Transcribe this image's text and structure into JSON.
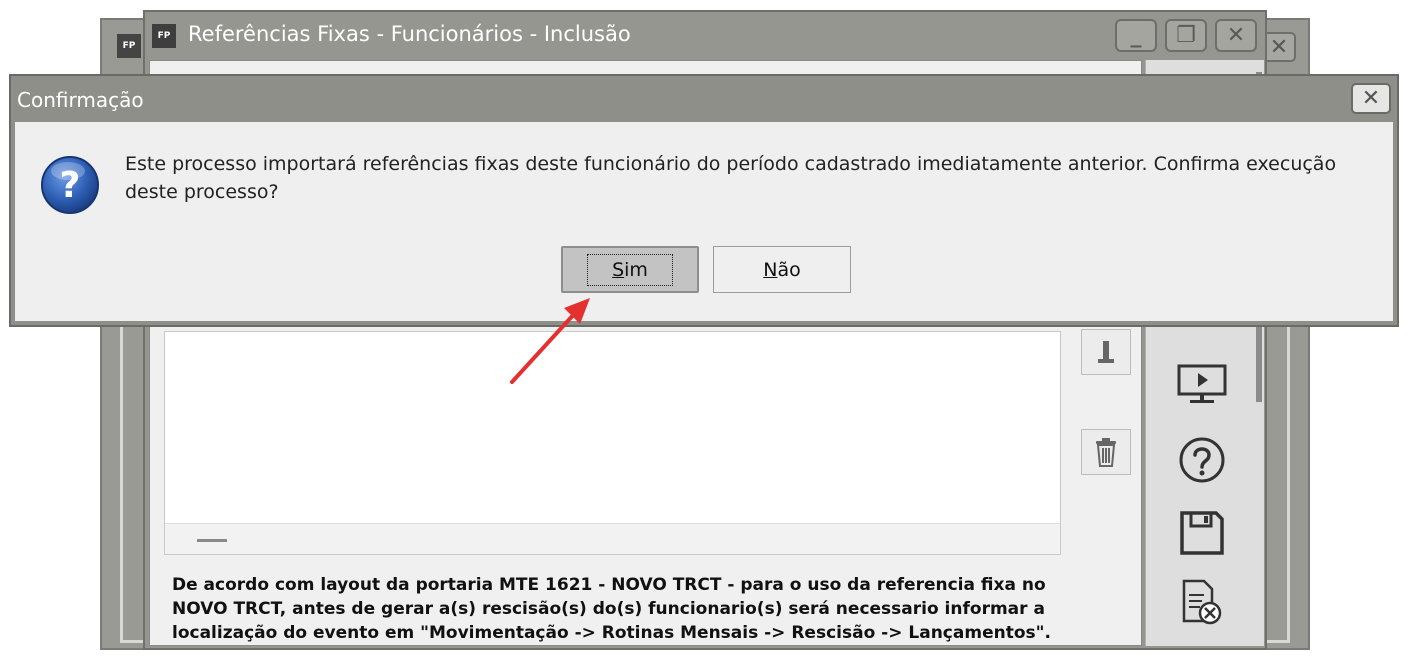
{
  "back_window": {
    "app_badge": "FP",
    "close_glyph": "✕"
  },
  "main_window": {
    "app_badge": "FP",
    "title": "Referências Fixas - Funcionários - Inclusão",
    "controls": {
      "minimize": "_",
      "restore": "❐",
      "close": "✕"
    },
    "note": "De acordo com layout da portaria MTE 1621 - NOVO TRCT - para o uso da referencia fixa no NOVO TRCT, antes de gerar a(s) rescisão(s) do(s) funcionario(s) será necessario informar a localização do evento em \"Movimentação -> Rotinas Mensais -> Rescisão -> Lançamentos\".",
    "toolbar_icons": [
      "edit-icon",
      "trash-icon"
    ],
    "side_icons": [
      "monitor-play-icon",
      "help-icon",
      "save-icon",
      "cancel-document-icon"
    ]
  },
  "dialog": {
    "title": "Confirmação",
    "close_glyph": "✕",
    "icon": "question-icon",
    "message": "Este processo importará referências fixas deste funcionário do período cadastrado imediatamente anterior. Confirma execução deste processo?",
    "buttons": {
      "yes": {
        "accel": "S",
        "rest": "im"
      },
      "no": {
        "accel": "N",
        "rest": "ão"
      }
    }
  },
  "colors": {
    "window_frame": "#969691",
    "dialog_frame": "#8f8f8a",
    "dialog_body": "#efefef",
    "annotation_arrow": "#e53030",
    "question_icon": "#2f62b8"
  }
}
